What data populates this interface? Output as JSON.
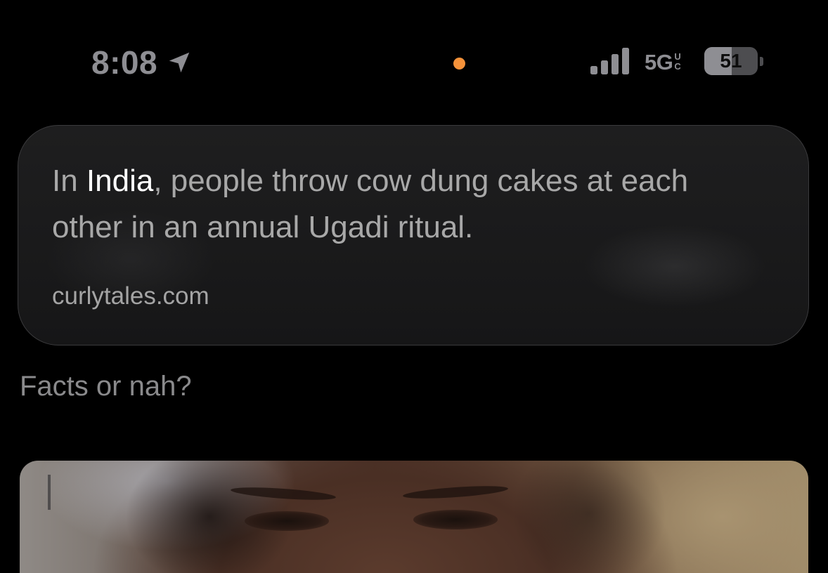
{
  "status_bar": {
    "time": "8:08",
    "location_icon": "location-arrow-icon",
    "mic_indicator_color": "#f5923a",
    "signal_icon": "cellular-signal-icon",
    "signal_bars": 4,
    "network": "5G",
    "network_suffix_top": "U",
    "network_suffix_bottom": "C",
    "battery_level": "51",
    "battery_fraction": 0.51
  },
  "post": {
    "quote_prefix": "In ",
    "quote_highlight": "India",
    "quote_rest": ", people throw cow dung cakes at each other in an annual Ugadi ritual.",
    "quote_source": "curlytales.com",
    "caption": "Facts or nah?"
  },
  "colors": {
    "background": "#000000",
    "card": "#1c1c1d",
    "highlight_text": "#ffffff",
    "muted_text": "#a8a8a8"
  }
}
